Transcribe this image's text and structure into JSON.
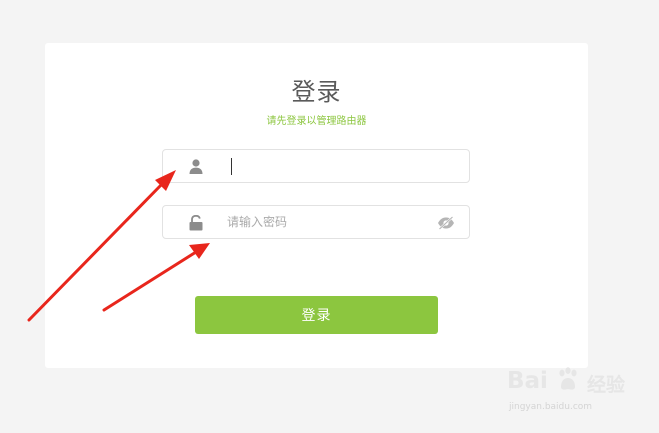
{
  "login": {
    "title": "登录",
    "subtitle": "请先登录以管理路由器",
    "username": {
      "icon": "user-icon",
      "value": ""
    },
    "password": {
      "icon": "lock-icon",
      "placeholder": "请输入密码",
      "value": "",
      "toggle_icon": "eye-slash-icon"
    },
    "submit_label": "登录"
  },
  "watermark": {
    "brand": "Bai",
    "brand_suffix": "经验",
    "url": "jingyan.baidu.com"
  },
  "colors": {
    "accent": "#8cc63f",
    "annotation_arrow": "#e8261c",
    "background": "#f4f4f4"
  }
}
